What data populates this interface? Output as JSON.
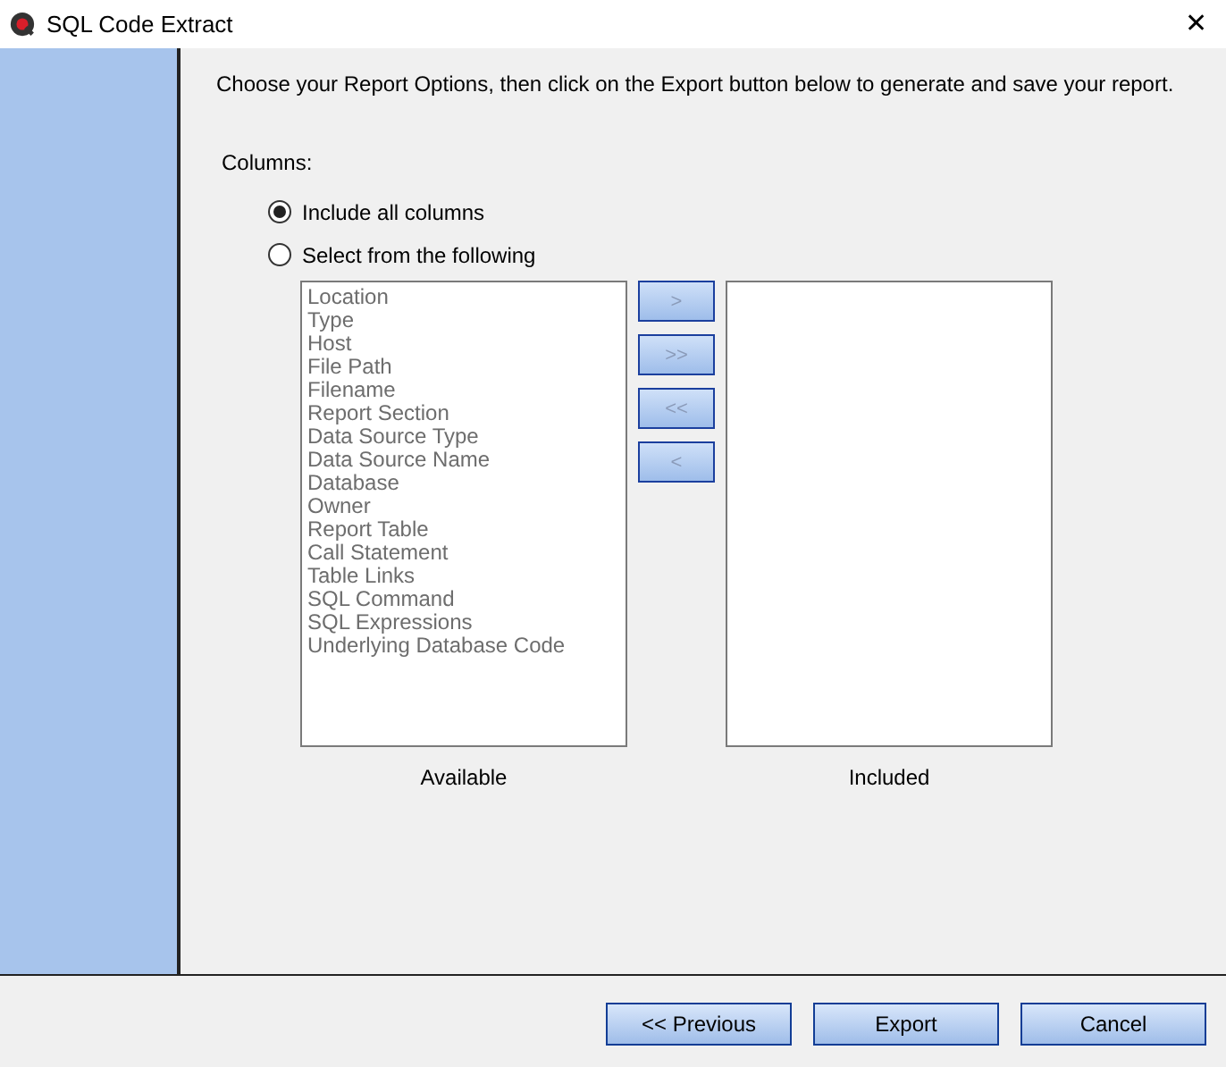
{
  "window": {
    "title": "SQL Code Extract",
    "close": "✕"
  },
  "instruction": "Choose your Report Options, then click on the Export button below to generate and save your report.",
  "columns_label": "Columns:",
  "options": [
    {
      "label": "Include all columns",
      "selected": true
    },
    {
      "label": "Select from the following",
      "selected": false
    }
  ],
  "available": {
    "label": "Available",
    "disabled": true,
    "items": [
      "Location",
      "Type",
      "Host",
      "File Path",
      "Filename",
      "Report Section",
      "Data Source Type",
      "Data Source Name",
      "Database",
      "Owner",
      "Report Table",
      "Call Statement",
      "Table Links",
      "SQL Command",
      "SQL Expressions",
      "Underlying Database Code"
    ]
  },
  "move_buttons": [
    {
      "label": ">",
      "disabled": true
    },
    {
      "label": ">>",
      "disabled": true
    },
    {
      "label": "<<",
      "disabled": true
    },
    {
      "label": "<",
      "disabled": true
    }
  ],
  "included": {
    "label": "Included"
  },
  "buttons": [
    "<< Previous",
    "Export",
    "Cancel"
  ]
}
